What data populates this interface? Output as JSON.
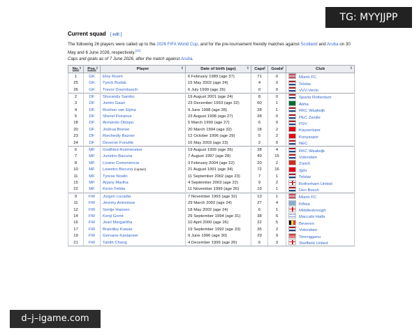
{
  "watermark_top": "TG: MYYJJPP",
  "watermark_bottom": "d–j–igame.com",
  "section": {
    "title": "Current squad",
    "edit": "[ edit ]"
  },
  "intro": {
    "t1": "The following 26 players were called up to the ",
    "l1": "2026 FIFA World Cup",
    "t2": ", and for the pre-tournament friendly matches against ",
    "l2": "Scotland",
    "t3": " and ",
    "l3": "Aruba",
    "t4": " on 30 May and 6 June 2026, respectively.",
    "ref": "[21]"
  },
  "note": {
    "t1": "Caps and goals as of 7 June 2026, after the match against ",
    "l1": "Aruba",
    "t2": "."
  },
  "headers": [
    "No.",
    "Pos.",
    "Player",
    "Date of birth (age)",
    "Caps",
    "Goals",
    "Club"
  ],
  "players": [
    {
      "no": "1",
      "pos": "GK",
      "name": "Eloy Room",
      "dob": "6 February 1989 (age 37)",
      "caps": "71",
      "goals": "0",
      "club": "Miami FC",
      "flag": "us"
    },
    {
      "no": "25",
      "pos": "GK",
      "name": "Tyrick Bodak",
      "dob": "15 May 2002 (age 24)",
      "caps": "4",
      "goals": "0",
      "club": "Telstar",
      "flag": "nl"
    },
    {
      "no": "26",
      "pos": "GK",
      "name": "Trevor Doornbusch",
      "dob": "6 July 1999 (age 26)",
      "caps": "0",
      "goals": "0",
      "club": "VVV-Venlo",
      "flag": "nl"
    },
    {
      "no": "2",
      "pos": "DF",
      "name": "Shurandy Sambo",
      "dob": "19 August 2001 (age 24)",
      "caps": "8",
      "goals": "0",
      "club": "Sparta Rotterdam",
      "flag": "nl"
    },
    {
      "no": "3",
      "pos": "DF",
      "name": "Juriën Gaari",
      "dob": "23 December 1993 (age 32)",
      "caps": "60",
      "goals": "1",
      "club": "Abha",
      "flag": "sa"
    },
    {
      "no": "4",
      "pos": "DF",
      "name": "Roshon van Eijma",
      "dob": "9 June 1998 (age 28)",
      "caps": "28",
      "goals": "1",
      "club": "RKC Waalwijk",
      "flag": "nl"
    },
    {
      "no": "5",
      "pos": "DF",
      "name": "Sherel Floranus",
      "dob": "23 August 1998 (age 27)",
      "caps": "28",
      "goals": "0",
      "club": "PEC Zwolle",
      "flag": "nl"
    },
    {
      "no": "18",
      "pos": "DF",
      "name": "Armando Obispo",
      "dob": "5 March 1999 (age 27)",
      "caps": "6",
      "goals": "0",
      "club": "PSV",
      "flag": "nl"
    },
    {
      "no": "20",
      "pos": "DF",
      "name": "Joshua Brenet",
      "dob": "20 March 1994 (age 32)",
      "caps": "18",
      "goals": "2",
      "club": "Kayserispor",
      "flag": "tr"
    },
    {
      "no": "23",
      "pos": "DF",
      "name": "Riechedly Bazoer",
      "dob": "12 October 1996 (age 29)",
      "caps": "5",
      "goals": "2",
      "club": "Konyaspor",
      "flag": "tr"
    },
    {
      "no": "24",
      "pos": "DF",
      "name": "Deveron Fonville",
      "dob": "16 May 2003 (age 23)",
      "caps": "2",
      "goals": "0",
      "club": "NEC",
      "flag": "nl"
    },
    {
      "no": "6",
      "pos": "MF",
      "name": "Godfried Roemeratoe",
      "dob": "19 August 1999 (age 26)",
      "caps": "28",
      "goals": "4",
      "club": "RKC Waalwijk",
      "flag": "nl"
    },
    {
      "no": "7",
      "pos": "MF",
      "name": "Juninho Bacuna",
      "dob": "7 August 1997 (age 28)",
      "caps": "49",
      "goals": "15",
      "club": "Volendam",
      "flag": "nl"
    },
    {
      "no": "8",
      "pos": "MF",
      "name": "Livano Comenencia",
      "dob": "3 February 2004 (age 22)",
      "caps": "20",
      "goals": "2",
      "club": "Zürich",
      "flag": "ch"
    },
    {
      "no": "10",
      "pos": "MF",
      "name": "Leandro Bacuna",
      "captain": "(captain)",
      "dob": "21 August 1991 (age 34)",
      "caps": "72",
      "goals": "16",
      "club": "Iğdır",
      "flag": "tr"
    },
    {
      "no": "11",
      "pos": "MF",
      "name": "Tyrese Noslin",
      "dob": "11 September 2002 (age 23)",
      "caps": "7",
      "goals": "1",
      "club": "Telstar",
      "flag": "nl"
    },
    {
      "no": "15",
      "pos": "MF",
      "name": "Arjany Martha",
      "dob": "4 September 2003 (age 22)",
      "caps": "9",
      "goals": "2",
      "club": "Rotherham United",
      "flag": "en"
    },
    {
      "no": "22",
      "pos": "MF",
      "name": "Kevin Felida",
      "dob": "11 November 1999 (age 26)",
      "caps": "19",
      "goals": "1",
      "club": "Den Bosch",
      "flag": "nl"
    },
    {
      "no": "9",
      "pos": "FW",
      "name": "Jürgen Locadia",
      "dob": "7 November 1993 (age 32)",
      "caps": "13",
      "goals": "1",
      "club": "Miami FC",
      "flag": "us"
    },
    {
      "no": "11",
      "pos": "FW",
      "name": "Jeremy Antonisse",
      "dob": "29 March 2002 (age 24)",
      "caps": "27",
      "goals": "4",
      "club": "Kifisia",
      "flag": "gr"
    },
    {
      "no": "12",
      "pos": "FW",
      "name": "Sontje Hansen",
      "dob": "18 May 2002 (age 24)",
      "caps": "6",
      "goals": "1",
      "club": "Middlesbrough",
      "flag": "en"
    },
    {
      "no": "14",
      "pos": "FW",
      "name": "Kenji Gorré",
      "dob": "29 September 1994 (age 31)",
      "caps": "38",
      "goals": "6",
      "club": "Maccabi Haifa",
      "flag": "il"
    },
    {
      "no": "16",
      "pos": "FW",
      "name": "Jearl Margaritha",
      "dob": "10 April 2000 (age 26)",
      "caps": "22",
      "goals": "5",
      "club": "Beveren",
      "flag": "be"
    },
    {
      "no": "17",
      "pos": "FW",
      "name": "Brandley Kuwas",
      "dob": "19 September 1992 (age 33)",
      "caps": "35",
      "goals": "2",
      "club": "Volendam",
      "flag": "nl"
    },
    {
      "no": "19",
      "pos": "FW",
      "name": "Gervane Kastaneer",
      "dob": "9 June 1996 (age 30)",
      "caps": "29",
      "goals": "9",
      "club": "Terengganu",
      "flag": "my"
    },
    {
      "no": "21",
      "pos": "FW",
      "name": "Tahith Chong",
      "dob": "4 December 1999 (age 26)",
      "caps": "6",
      "goals": "3",
      "club": "Sheffield United",
      "flag": "en"
    }
  ],
  "flag_styles": {
    "us": "linear-gradient(to bottom,#b22234 0 14%,#fff 14% 28%,#b22234 28% 42%,#fff 42% 57%,#b22234 57% 71%,#fff 71% 85%,#b22234 85%)",
    "nl": "linear-gradient(to bottom,#ae1c28 0 33%,#ffffff 33% 66%,#21468b 66%)",
    "sa": "#006c35",
    "tr": "#e30a17",
    "ch": "#d52b1e",
    "en": "linear-gradient(#ce1124,#ce1124) center/100% 20% no-repeat, linear-gradient(#ce1124,#ce1124) center/20% 100% no-repeat, #ffffff",
    "gr": "repeating-linear-gradient(to bottom,#0d5eaf 0 11%,#ffffff 11% 22%)",
    "il": "linear-gradient(to bottom,#fff 0 15%,#0038b8 15% 28%,#fff 28% 72%,#0038b8 72% 85%,#fff 85%)",
    "be": "linear-gradient(to right,#000 0 33%,#fdda24 33% 66%,#ef3340 66%)",
    "my": "repeating-linear-gradient(to bottom,#cc0001 0 7%,#ffffff 7% 14%)"
  }
}
